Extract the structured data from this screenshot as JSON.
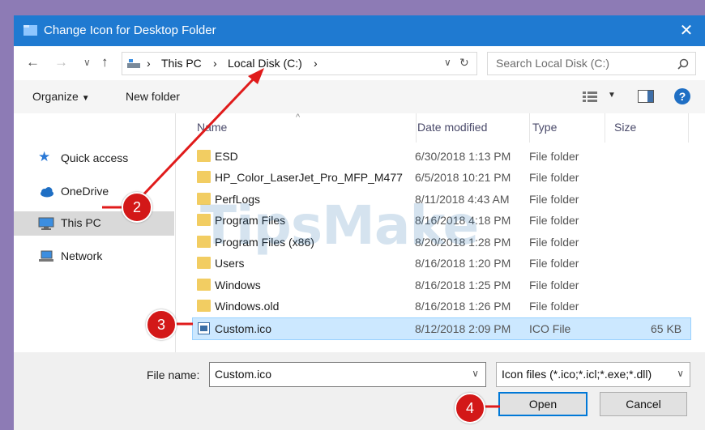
{
  "window": {
    "title": "Change Icon for Desktop Folder"
  },
  "address": {
    "crumbs": [
      "This PC",
      "Local Disk (C:)"
    ],
    "separator": "›"
  },
  "search": {
    "placeholder": "Search Local Disk (C:)"
  },
  "toolbar": {
    "organize_label": "Organize",
    "new_folder_label": "New folder"
  },
  "sidebar": {
    "items": [
      {
        "label": "Quick access",
        "icon": "star-icon"
      },
      {
        "label": "OneDrive",
        "icon": "cloud-icon"
      },
      {
        "label": "This PC",
        "icon": "computer-icon",
        "selected": true
      },
      {
        "label": "Network",
        "icon": "network-icon"
      }
    ]
  },
  "columns": {
    "name": "Name",
    "date": "Date modified",
    "type": "Type",
    "size": "Size"
  },
  "files": [
    {
      "name": "ESD",
      "date": "6/30/2018 1:13 PM",
      "type": "File folder",
      "size": ""
    },
    {
      "name": "HP_Color_LaserJet_Pro_MFP_M477",
      "date": "6/5/2018 10:21 PM",
      "type": "File folder",
      "size": ""
    },
    {
      "name": "PerfLogs",
      "date": "8/11/2018 4:43 AM",
      "type": "File folder",
      "size": ""
    },
    {
      "name": "Program Files",
      "date": "8/16/2018 4:18 PM",
      "type": "File folder",
      "size": ""
    },
    {
      "name": "Program Files (x86)",
      "date": "8/20/2018 1:28 PM",
      "type": "File folder",
      "size": ""
    },
    {
      "name": "Users",
      "date": "8/16/2018 1:20 PM",
      "type": "File folder",
      "size": ""
    },
    {
      "name": "Windows",
      "date": "8/16/2018 1:25 PM",
      "type": "File folder",
      "size": ""
    },
    {
      "name": "Windows.old",
      "date": "8/16/2018 1:26 PM",
      "type": "File folder",
      "size": ""
    },
    {
      "name": "Custom.ico",
      "date": "8/12/2018 2:09 PM",
      "type": "ICO File",
      "size": "65 KB",
      "selected": true
    }
  ],
  "filename": {
    "label": "File name:",
    "value": "Custom.ico"
  },
  "filter": {
    "value": "Icon files (*.ico;*.icl;*.exe;*.dll)"
  },
  "buttons": {
    "open": "Open",
    "cancel": "Cancel"
  },
  "annotations": [
    "2",
    "3",
    "4"
  ],
  "watermark": "TipsMake",
  "colors": {
    "titlebar": "#1f7ad1",
    "selection": "#cce8ff",
    "marker": "#d31818",
    "arrow": "#e01b1b",
    "folder": "#f2cd62"
  }
}
